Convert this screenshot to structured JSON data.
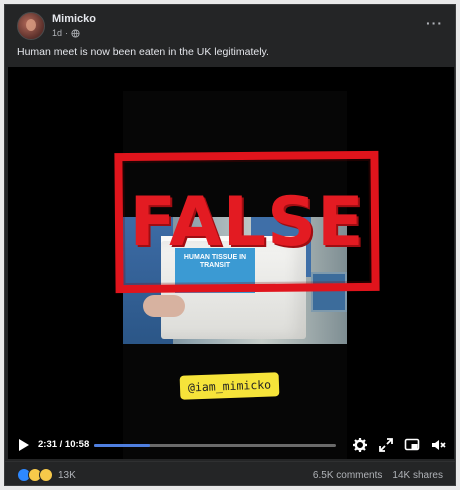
{
  "post": {
    "page_name": "Mimicko",
    "time": "1d",
    "separator": "·",
    "more": "···",
    "caption": "Human meet is now been eaten in the UK legitimately."
  },
  "video": {
    "stamp": "FALSE",
    "box_label": "HUMAN TISSUE IN TRANSIT",
    "handle": "@iam_mimicko",
    "time": "2:31 / 10:58",
    "progress": 0.23
  },
  "footer": {
    "reaction_count": "13K",
    "comments": "6.5K comments",
    "shares": "14K shares"
  },
  "colors": {
    "background": "#242526",
    "stamp_red": "#e0141c",
    "progress_blue": "#4f7fe0",
    "handle_yellow": "#f6e43a"
  }
}
